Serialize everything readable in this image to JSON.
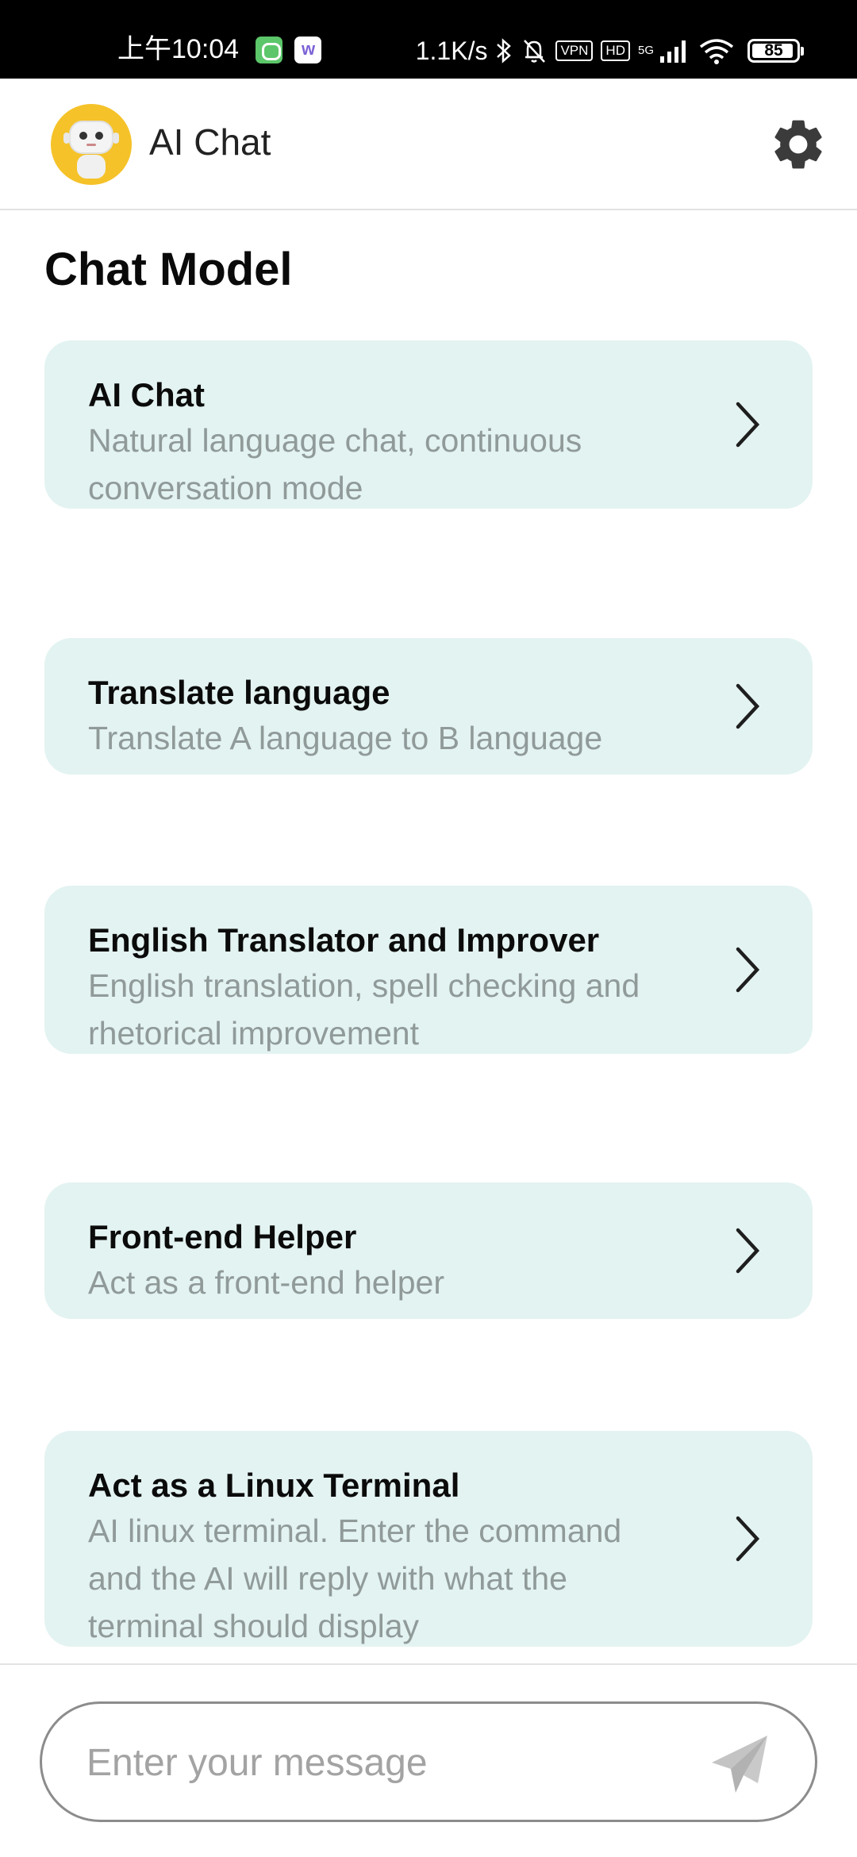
{
  "status_bar": {
    "time": "上午10:04",
    "net_speed": "1.1K/s",
    "vpn": "VPN",
    "hd": "HD",
    "network": "5G",
    "battery": "85"
  },
  "header": {
    "title": "AI Chat"
  },
  "main": {
    "section_title": "Chat Model",
    "cards": [
      {
        "title": "AI Chat",
        "description": "Natural language chat, continuous conversation mode"
      },
      {
        "title": "Translate language",
        "description": "Translate A language to B language"
      },
      {
        "title": "English Translator and Improver",
        "description": "English translation, spell checking and rhetorical improvement"
      },
      {
        "title": "Front-end Helper",
        "description": "Act as a front-end helper"
      },
      {
        "title": "Act as a Linux Terminal",
        "description": "AI linux terminal. Enter the command and the AI will reply with what the terminal should display"
      }
    ]
  },
  "composer": {
    "placeholder": "Enter your message"
  },
  "colors": {
    "card_background": "#e3f3f1",
    "avatar_background": "#f5c229",
    "description_text": "#8f9a99"
  }
}
